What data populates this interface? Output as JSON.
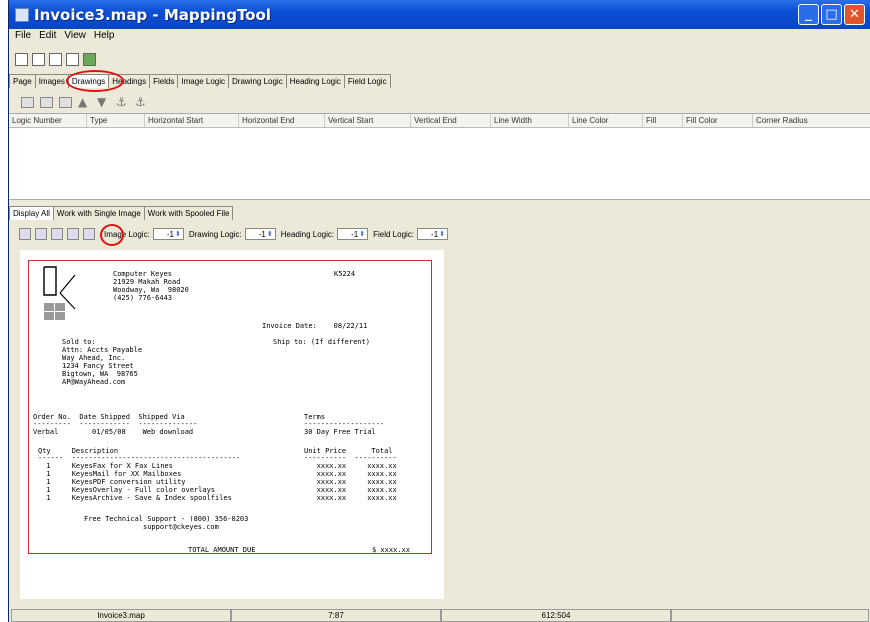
{
  "window": {
    "title": "Invoice3.map - MappingTool"
  },
  "menu": [
    "File",
    "Edit",
    "View",
    "Help"
  ],
  "top_tabs": [
    "Page",
    "Images",
    "Drawings",
    "Headings",
    "Fields",
    "Image Logic",
    "Drawing Logic",
    "Heading Logic",
    "Field Logic"
  ],
  "active_top_tab": "Drawings",
  "columns": [
    "Logic Number",
    "Type",
    "Horizontal Start",
    "Horizontal End",
    "Vertical Start",
    "Vertical End",
    "Line Width",
    "Line Color",
    "Fill",
    "Fill Color",
    "Corner Radius"
  ],
  "bottom_tabs": [
    "Display All",
    "Work with Single Image",
    "Work with Spooled File"
  ],
  "logic": {
    "image_label": "Image Logic:",
    "image_value": "-1",
    "drawing_label": "Drawing Logic:",
    "drawing_value": "-1",
    "heading_label": "Heading Logic:",
    "heading_value": "-1",
    "field_label": "Field Logic:",
    "field_value": "-1"
  },
  "doc": {
    "company": "Computer Keyes\n21929 Makah Road\nWoodway, Wa  98020\n(425) 776-6443",
    "invoice_no": "K5224",
    "invoice_date": "Invoice Date:    08/22/11",
    "ship_to": "Ship to: (If different)",
    "sold_to": "Sold to:\nAttn: Accts Payable\nWay Ahead, Inc.\n1234 Fancy Street\nBigtown, WA  98765\nAP@WayAhead.com",
    "order_header": "Order No.  Date Shipped  Shipped Via",
    "order_dashes": "---------  ------------  --------------",
    "order_row": "Verbal        01/05/08    Web download",
    "terms_header": "Terms",
    "terms_dashes": "-------------------",
    "terms_row": "30 Day Free Trial",
    "items_header": "Qty     Description",
    "items_dashes": "------  ----------------------------------------",
    "items": "  1     KeyesFax for X Fax Lines\n  1     KeyesMail for XX Mailboxes\n  1     KeyesPDF conversion utility\n  1     KeyesOverlay - Full color overlays\n  1     KeyesArchive - Save & Index spoolfiles",
    "price_header": "Unit Price      Total",
    "price_dashes": "----------  ----------",
    "prices": "   xxxx.xx     xxxx.xx\n   xxxx.xx     xxxx.xx\n   xxxx.xx     xxxx.xx\n   xxxx.xx     xxxx.xx\n   xxxx.xx     xxxx.xx",
    "support": "Free Technical Support - (800) 356-0203\n              support@ckeyes.com",
    "total_label": "TOTAL AMOUNT DUE",
    "total_value": "$ xxxx.xx"
  },
  "status": {
    "file": "Invoice3.map",
    "scale": "7:87",
    "coords": "612:504"
  }
}
